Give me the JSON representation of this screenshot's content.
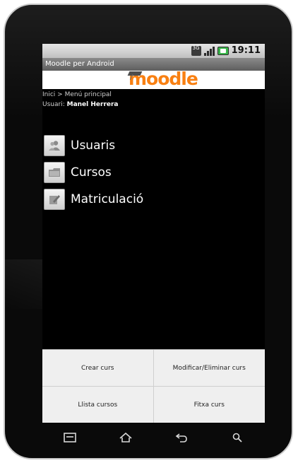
{
  "status_bar": {
    "time": "19:11",
    "network_badge": "3G",
    "icons": [
      "3g-icon",
      "signal-icon",
      "battery-icon"
    ]
  },
  "app": {
    "title": "Moodle per Android",
    "logo_text": "moodle"
  },
  "breadcrumb": {
    "text": "Inici > Menú principal"
  },
  "user": {
    "prefix": "Usuari:",
    "name": "Manel Herrera"
  },
  "menu": {
    "items": [
      {
        "label": "Usuaris",
        "icon": "users-icon"
      },
      {
        "label": "Cursos",
        "icon": "folder-icon"
      },
      {
        "label": "Matriculació",
        "icon": "edit-icon"
      }
    ]
  },
  "bottom_menu": {
    "items": [
      {
        "label": "Crear curs"
      },
      {
        "label": "Modificar/Eliminar curs"
      },
      {
        "label": "Llista cursos"
      },
      {
        "label": "Fitxa curs"
      }
    ]
  },
  "navbar": {
    "buttons": [
      "menu-icon",
      "home-icon",
      "back-icon",
      "search-icon"
    ]
  }
}
